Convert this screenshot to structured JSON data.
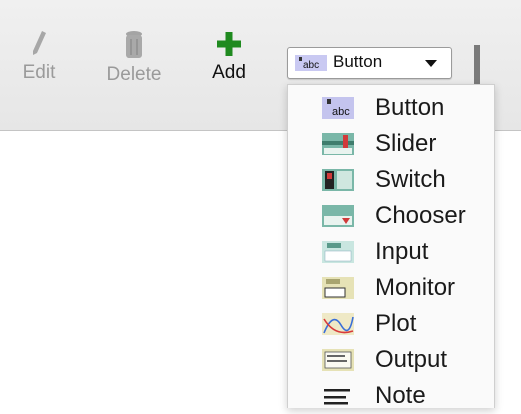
{
  "toolbar": {
    "edit_label": "Edit",
    "delete_label": "Delete",
    "add_label": "Add",
    "selected_widget": "Button",
    "icon_badge_text": "abc"
  },
  "menu": {
    "items": [
      {
        "label": "Button",
        "icon": "button-widget-icon"
      },
      {
        "label": "Slider",
        "icon": "slider-widget-icon"
      },
      {
        "label": "Switch",
        "icon": "switch-widget-icon"
      },
      {
        "label": "Chooser",
        "icon": "chooser-widget-icon"
      },
      {
        "label": "Input",
        "icon": "input-widget-icon"
      },
      {
        "label": "Monitor",
        "icon": "monitor-widget-icon"
      },
      {
        "label": "Plot",
        "icon": "plot-widget-icon"
      },
      {
        "label": "Output",
        "icon": "output-widget-icon"
      },
      {
        "label": "Note",
        "icon": "note-widget-icon"
      }
    ]
  },
  "colors": {
    "add_green": "#1f8a1f",
    "disabled_gray": "#9a9a9a"
  }
}
